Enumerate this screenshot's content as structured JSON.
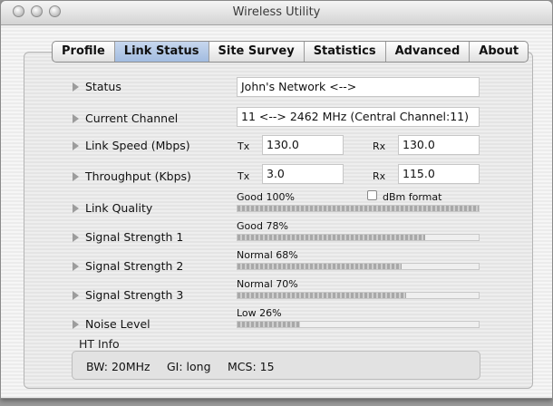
{
  "window": {
    "title": "Wireless Utility"
  },
  "tabs": [
    {
      "label": "Profile"
    },
    {
      "label": "Link Status"
    },
    {
      "label": "Site Survey"
    },
    {
      "label": "Statistics"
    },
    {
      "label": "Advanced"
    },
    {
      "label": "About"
    }
  ],
  "active_tab": "Link Status",
  "status": {
    "label": "Status",
    "value": "John's Network <-->"
  },
  "channel": {
    "label": "Current Channel",
    "value": "11 <--> 2462 MHz (Central Channel:11)"
  },
  "link_speed": {
    "label": "Link Speed  (Mbps)",
    "tx_label": "Tx",
    "tx": "130.0",
    "rx_label": "Rx",
    "rx": "130.0"
  },
  "throughput": {
    "label": "Throughput (Kbps)",
    "tx_label": "Tx",
    "tx": "3.0",
    "rx_label": "Rx",
    "rx": "115.0"
  },
  "link_quality": {
    "label": "Link Quality",
    "text": "Good 100%",
    "value": 100,
    "dbm_label": "dBm format",
    "dbm_checked": false
  },
  "signal1": {
    "label": "Signal Strength 1",
    "text": "Good 78%",
    "value": 78
  },
  "signal2": {
    "label": "Signal Strength 2",
    "text": "Normal 68%",
    "value": 68
  },
  "signal3": {
    "label": "Signal Strength 3",
    "text": "Normal 70%",
    "value": 70
  },
  "noise": {
    "label": "Noise Level",
    "text": "Low 26%",
    "value": 26
  },
  "ht_info": {
    "title": "HT Info",
    "bw": "BW: 20MHz",
    "gi": "GI: long",
    "mcs": "MCS: 15"
  },
  "colors": {
    "active_tab": "#a2bce0",
    "bar_fill": "#a8a8a8"
  }
}
